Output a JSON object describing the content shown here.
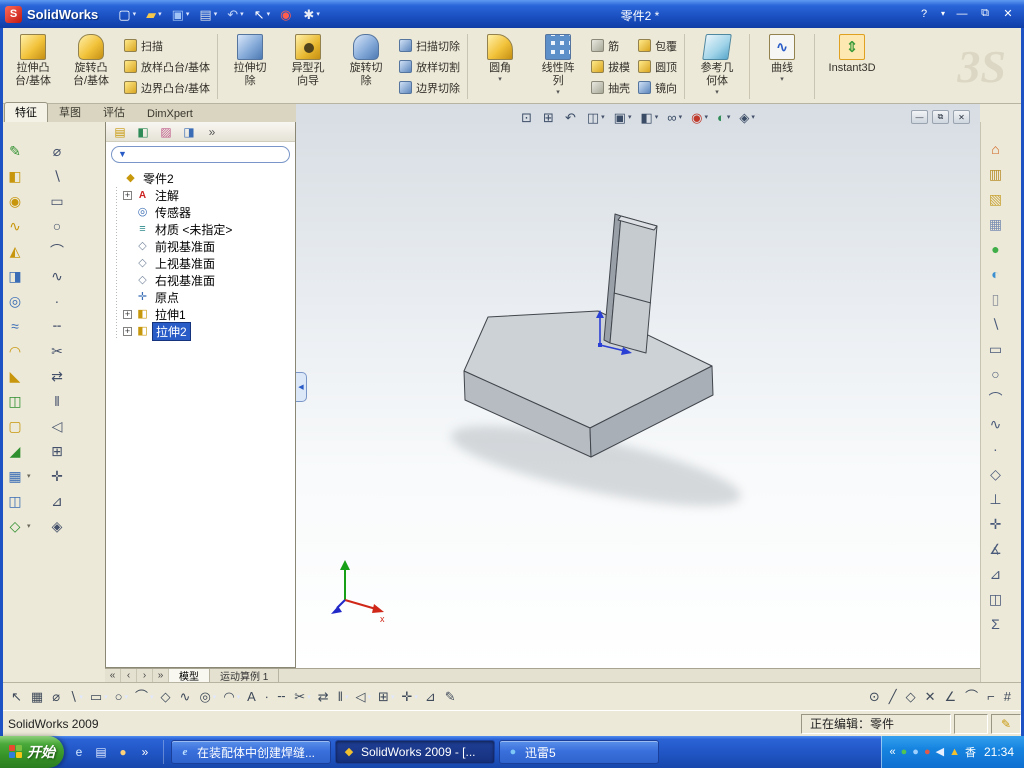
{
  "glyphs": {
    "dropdown": "▾",
    "plus": "+",
    "minimize": "—",
    "restore": "⧉",
    "close": "✕",
    "funnel": "▼",
    "collapse": "◀",
    "wave": "∿",
    "updown": "⇕"
  },
  "window": {
    "logo_badge": "S",
    "app_name": "SolidWorks",
    "title": "零件2 *",
    "help_label": "?"
  },
  "titlebar_tools": [
    {
      "name": "new-document-icon",
      "glyph": "▢",
      "color": "#ffffff",
      "arrow": true
    },
    {
      "name": "open-document-icon",
      "glyph": "▰",
      "color": "#f5c84c",
      "arrow": true
    },
    {
      "name": "save-icon",
      "glyph": "▣",
      "color": "#9fc3f5",
      "arrow": true
    },
    {
      "name": "print-icon",
      "glyph": "▤",
      "color": "#d5dce8",
      "arrow": true
    },
    {
      "name": "undo-icon",
      "glyph": "↶",
      "color": "#bcd2f7",
      "arrow": true
    },
    {
      "name": "select-icon",
      "glyph": "↖",
      "color": "#ffffff",
      "arrow": true
    },
    {
      "name": "rebuild-icon",
      "glyph": "◉",
      "color": "#ff5d4d",
      "arrow": false
    },
    {
      "name": "options-icon",
      "glyph": "✱",
      "color": "#e8edf6",
      "arrow": true
    }
  ],
  "ribbon": {
    "watermark": "3S",
    "groups": [
      {
        "name": "extruded-boss-base",
        "lines": [
          "拉伸凸",
          "台/基体"
        ]
      },
      {
        "name": "revolved-boss-base",
        "lines": [
          "旋转凸",
          "台/基体"
        ]
      },
      {
        "name": "boss-stack",
        "items": [
          {
            "name": "swept-boss",
            "label": "扫描"
          },
          {
            "name": "lofted-boss",
            "label": "放样凸台/基体"
          },
          {
            "name": "boundary-boss",
            "label": "边界凸台/基体"
          }
        ]
      },
      {
        "name": "extruded-cut",
        "lines": [
          "拉伸切",
          "除"
        ]
      },
      {
        "name": "hole-wizard",
        "lines": [
          "异型孔",
          "向导"
        ]
      },
      {
        "name": "revolved-cut",
        "lines": [
          "旋转切",
          "除"
        ]
      },
      {
        "name": "cut-stack",
        "items": [
          {
            "name": "swept-cut",
            "label": "扫描切除"
          },
          {
            "name": "lofted-cut",
            "label": "放样切割"
          },
          {
            "name": "boundary-cut",
            "label": "边界切除"
          }
        ]
      },
      {
        "name": "fillet",
        "lines": [
          "圆角"
        ],
        "arrow": true
      },
      {
        "name": "linear-pattern",
        "lines": [
          "线性阵",
          "列"
        ],
        "arrow": true
      },
      {
        "name": "rib-stack",
        "items": [
          {
            "name": "rib",
            "label": "筋"
          },
          {
            "name": "draft",
            "label": "拔模"
          },
          {
            "name": "shell",
            "label": "抽壳"
          }
        ]
      },
      {
        "name": "wrap-stack",
        "items": [
          {
            "name": "wrap",
            "label": "包覆"
          },
          {
            "name": "dome",
            "label": "圆顶"
          },
          {
            "name": "mirror",
            "label": "镜向"
          }
        ]
      },
      {
        "name": "reference-geometry",
        "lines": [
          "参考几",
          "何体"
        ],
        "arrow": true
      },
      {
        "name": "curves",
        "lines": [
          "曲线"
        ],
        "arrow": true
      },
      {
        "name": "instant3d",
        "lines": [
          "Instant3D"
        ]
      }
    ]
  },
  "tabs": [
    "特征",
    "草图",
    "评估",
    "DimXpert"
  ],
  "manager_tabs": [
    {
      "name": "featuremanager-tab-icon",
      "glyph": "▤",
      "color": "#c8980c"
    },
    {
      "name": "propertymanager-tab-icon",
      "glyph": "◧",
      "color": "#2e8b57"
    },
    {
      "name": "configurationmanager-tab-icon",
      "glyph": "▨",
      "color": "#c05a8a"
    },
    {
      "name": "dimxpertmanager-tab-icon",
      "glyph": "◨",
      "color": "#3a6db5"
    },
    {
      "name": "panel-overflow-icon",
      "glyph": "»",
      "color": "#555555"
    }
  ],
  "feature_panel": {
    "filter_placeholder": "",
    "items": [
      {
        "label": "零件2",
        "glyph": "◆"
      },
      {
        "label": "注解",
        "glyph": "A"
      },
      {
        "label": "传感器",
        "glyph": "◎"
      },
      {
        "label": "材质 <未指定>",
        "glyph": "≡"
      },
      {
        "label": "前视基准面",
        "glyph": "◇"
      },
      {
        "label": "上视基准面",
        "glyph": "◇"
      },
      {
        "label": "右视基准面",
        "glyph": "◇"
      },
      {
        "label": "原点",
        "glyph": "✛"
      },
      {
        "label": "拉伸1",
        "glyph": "◧"
      },
      {
        "label": "拉伸2",
        "glyph": "◧"
      }
    ]
  },
  "headsup_tools": [
    {
      "name": "zoom-to-fit-icon",
      "glyph": "⊡",
      "color": "#3b4c66"
    },
    {
      "name": "zoom-to-area-icon",
      "glyph": "⊞",
      "color": "#3b4c66"
    },
    {
      "name": "previous-view-icon",
      "glyph": "↶",
      "color": "#3b4c66"
    },
    {
      "name": "section-view-icon",
      "glyph": "◫",
      "color": "#3b4c66",
      "arrow": true
    },
    {
      "name": "view-orientation-icon",
      "glyph": "▣",
      "color": "#3b4c66",
      "arrow": true
    },
    {
      "name": "display-style-icon",
      "glyph": "◧",
      "color": "#3b4c66",
      "arrow": true
    },
    {
      "name": "hide-show-items-icon",
      "glyph": "∞",
      "color": "#3b4c66",
      "arrow": true
    },
    {
      "name": "edit-appearance-icon",
      "glyph": "◉",
      "color": "#c0392b",
      "arrow": true
    },
    {
      "name": "apply-scene-icon",
      "glyph": "◐",
      "color": "#2e8b57",
      "arrow": true
    },
    {
      "name": "view-settings-icon",
      "glyph": "◈",
      "color": "#3b4c66",
      "arrow": true
    }
  ],
  "left_toolbar_1": [
    {
      "name": "sketch-icon",
      "glyph": "✎",
      "color": "#2f8f2f"
    },
    {
      "name": "extruded-boss-icon",
      "glyph": "◧",
      "color": "#c8960c"
    },
    {
      "name": "revolved-boss-icon",
      "glyph": "◉",
      "color": "#c8960c"
    },
    {
      "name": "swept-boss-icon",
      "glyph": "∿",
      "color": "#c8960c"
    },
    {
      "name": "lofted-boss-icon",
      "glyph": "◭",
      "color": "#c8960c"
    },
    {
      "name": "extruded-cut-icon",
      "glyph": "◨",
      "color": "#3a6db5"
    },
    {
      "name": "revolved-cut-icon",
      "glyph": "◎",
      "color": "#3a6db5"
    },
    {
      "name": "swept-cut-icon",
      "glyph": "≈",
      "color": "#3a6db5"
    },
    {
      "name": "fillet-icon",
      "glyph": "◠",
      "color": "#c8960c"
    },
    {
      "name": "chamfer-icon",
      "glyph": "◣",
      "color": "#c8960c"
    },
    {
      "name": "rib-icon",
      "glyph": "◫",
      "color": "#2f8f2f"
    },
    {
      "name": "shell-icon",
      "glyph": "▢",
      "color": "#c8960c"
    },
    {
      "name": "draft-icon",
      "glyph": "◢",
      "color": "#2f8f2f"
    },
    {
      "name": "linear-pattern-icon",
      "glyph": "▦",
      "color": "#3a6db5",
      "arrow": true
    },
    {
      "name": "mirror-feature-icon",
      "glyph": "◫",
      "color": "#3a6db5"
    },
    {
      "name": "reference-geometry-icon",
      "glyph": "◇",
      "color": "#2f8f2f",
      "arrow": true
    }
  ],
  "left_toolbar_2": [
    {
      "name": "smart-dimension-icon",
      "glyph": "⌀",
      "color": "#44506a"
    },
    {
      "name": "line-icon",
      "glyph": "∖",
      "color": "#44506a"
    },
    {
      "name": "rectangle-icon",
      "glyph": "▭",
      "color": "#44506a"
    },
    {
      "name": "circle-icon",
      "glyph": "○",
      "color": "#44506a"
    },
    {
      "name": "arc-icon",
      "glyph": "⌒",
      "color": "#44506a"
    },
    {
      "name": "spline-icon",
      "glyph": "∿",
      "color": "#44506a"
    },
    {
      "name": "point-icon",
      "glyph": "∙",
      "color": "#44506a"
    },
    {
      "name": "centerline-icon",
      "glyph": "╌",
      "color": "#44506a"
    },
    {
      "name": "trim-icon",
      "glyph": "✂",
      "color": "#44506a"
    },
    {
      "name": "convert-entities-icon",
      "glyph": "⇄",
      "color": "#44506a"
    },
    {
      "name": "offset-entities-icon",
      "glyph": "‖",
      "color": "#44506a"
    },
    {
      "name": "mirror-entities-icon",
      "glyph": "◁",
      "color": "#44506a"
    },
    {
      "name": "sketch-pattern-icon",
      "glyph": "⊞",
      "color": "#44506a"
    },
    {
      "name": "move-entities-icon",
      "glyph": "✛",
      "color": "#44506a"
    },
    {
      "name": "display-relations-icon",
      "glyph": "⊿",
      "color": "#44506a"
    },
    {
      "name": "quick-snaps-icon",
      "glyph": "◈",
      "color": "#44506a"
    }
  ],
  "right_panel_tools": [
    {
      "name": "solidworks-resources-icon",
      "glyph": "⌂",
      "color": "#d0641e"
    },
    {
      "name": "design-library-icon",
      "glyph": "▥",
      "color": "#b8912e"
    },
    {
      "name": "file-explorer-icon",
      "glyph": "▧",
      "color": "#caa53a"
    },
    {
      "name": "view-palette-icon",
      "glyph": "▦",
      "color": "#7a8fb3"
    },
    {
      "name": "appearances-icon",
      "glyph": "●",
      "color": "#3fae49"
    },
    {
      "name": "scenes-icon",
      "glyph": "◐",
      "color": "#3a8fd0"
    },
    {
      "name": "custom-properties-icon",
      "glyph": "▯",
      "color": "#8a8f99"
    },
    {
      "name": "line-tool-icon",
      "glyph": "∖",
      "color": "#4a5a7a"
    },
    {
      "name": "rectangle-tool-icon",
      "glyph": "▭",
      "color": "#4a5a7a"
    },
    {
      "name": "circle-tool-icon",
      "glyph": "○",
      "color": "#4a5a7a"
    },
    {
      "name": "arc-tool-icon",
      "glyph": "⌒",
      "color": "#4a5a7a"
    },
    {
      "name": "spline-tool-icon",
      "glyph": "∿",
      "color": "#4a5a7a"
    },
    {
      "name": "point-tool-icon",
      "glyph": "∙",
      "color": "#4a5a7a"
    },
    {
      "name": "plane-icon",
      "glyph": "◇",
      "color": "#4a5a7a"
    },
    {
      "name": "axis-icon",
      "glyph": "⊥",
      "color": "#4a5a7a"
    },
    {
      "name": "coordinate-system-icon",
      "glyph": "✛",
      "color": "#4a5a7a"
    },
    {
      "name": "measure-icon",
      "glyph": "∡",
      "color": "#4a5a7a"
    },
    {
      "name": "mass-properties-icon",
      "glyph": "⊿",
      "color": "#4a5a7a"
    },
    {
      "name": "section-properties-icon",
      "glyph": "◫",
      "color": "#4a5a7a"
    },
    {
      "name": "equations-icon",
      "glyph": "Σ",
      "color": "#4a5a7a"
    }
  ],
  "bottom_tools_left": [
    {
      "name": "select-icon",
      "glyph": "↖",
      "color": "#3f4a5a"
    },
    {
      "name": "grid-icon",
      "glyph": "▦",
      "color": "#3f4a5a"
    },
    {
      "name": "smart-dimension-icon",
      "glyph": "⌀",
      "color": "#3f4a5a"
    },
    {
      "name": "line-icon",
      "glyph": "∖",
      "color": "#3f4a5a",
      "arrow": true
    },
    {
      "name": "rectangle-icon",
      "glyph": "▭",
      "color": "#3f4a5a",
      "arrow": true
    },
    {
      "name": "circle-icon",
      "glyph": "○",
      "color": "#3f4a5a",
      "arrow": true
    },
    {
      "name": "arc-icon",
      "glyph": "⌒",
      "color": "#3f4a5a",
      "arrow": true
    },
    {
      "name": "polygon-icon",
      "glyph": "◇",
      "color": "#3f4a5a"
    },
    {
      "name": "spline-icon",
      "glyph": "∿",
      "color": "#3f4a5a"
    },
    {
      "name": "ellipse-icon",
      "glyph": "◎",
      "color": "#3f4a5a",
      "arrow": true
    },
    {
      "name": "sketch-fillet-icon",
      "glyph": "◠",
      "color": "#3f4a5a",
      "arrow": true
    },
    {
      "name": "text-icon",
      "glyph": "A",
      "color": "#3f4a5a"
    },
    {
      "name": "point-icon",
      "glyph": "∙",
      "color": "#3f4a5a"
    },
    {
      "name": "centerline-icon",
      "glyph": "╌",
      "color": "#3f4a5a"
    },
    {
      "name": "trim-entities-icon",
      "glyph": "✂",
      "color": "#3f4a5a",
      "arrow": true
    },
    {
      "name": "convert-entities-icon",
      "glyph": "⇄",
      "color": "#3f4a5a"
    },
    {
      "name": "offset-entities-icon",
      "glyph": "‖",
      "color": "#3f4a5a",
      "arrow": true
    },
    {
      "name": "mirror-entities-icon",
      "glyph": "◁",
      "color": "#3f4a5a",
      "arrow": true
    },
    {
      "name": "linear-sketch-pattern-icon",
      "glyph": "⊞",
      "color": "#3f4a5a",
      "arrow": true
    },
    {
      "name": "move-entities-icon",
      "glyph": "✛",
      "color": "#3f4a5a",
      "arrow": true
    },
    {
      "name": "display-relations-icon",
      "glyph": "⊿",
      "color": "#3f4a5a"
    },
    {
      "name": "rapid-sketch-icon",
      "glyph": "✎",
      "color": "#3f4a5a"
    }
  ],
  "bottom_tools_right": [
    {
      "name": "circle-snap-icon",
      "glyph": "⊙",
      "color": "#3f4a5a"
    },
    {
      "name": "line-snap-icon",
      "glyph": "╱",
      "color": "#3f4a5a"
    },
    {
      "name": "diamond-snap-icon",
      "glyph": "◇",
      "color": "#3f4a5a"
    },
    {
      "name": "intersection-snap-icon",
      "glyph": "✕",
      "color": "#3f4a5a"
    },
    {
      "name": "angle-snap-icon",
      "glyph": "∠",
      "color": "#3f4a5a"
    },
    {
      "name": "arc-snap-icon",
      "glyph": "⌒",
      "color": "#3f4a5a"
    },
    {
      "name": "corner-snap-icon",
      "glyph": "⌐",
      "color": "#3f4a5a"
    },
    {
      "name": "grid-snap-icon",
      "glyph": "#",
      "color": "#3f4a5a"
    }
  ],
  "bottom_tabs": {
    "nav": [
      "«",
      "‹",
      "›",
      "»"
    ],
    "tabs": [
      {
        "label": "模型",
        "active": true
      },
      {
        "label": "运动算例 1",
        "active": false
      }
    ]
  },
  "statusbar": {
    "app": "SolidWorks 2009",
    "editing": "正在编辑：零件",
    "icon": "✎"
  },
  "taskbar": {
    "start_label": "开始",
    "quick_launch": [
      {
        "name": "quick-launch-ie-icon",
        "glyph": "e",
        "color": "#cfe6ff"
      },
      {
        "name": "quick-launch-show-desktop-icon",
        "glyph": "▤",
        "color": "#dfe8ff"
      },
      {
        "name": "quick-launch-media-icon",
        "glyph": "●",
        "color": "#ffd27a"
      },
      {
        "name": "quick-launch-expand-icon",
        "glyph": "»",
        "color": "#ffffff"
      }
    ],
    "buttons": [
      {
        "label": "在装配体中创建焊缝...",
        "glyph": "e"
      },
      {
        "label": "SolidWorks 2009 - [...",
        "glyph": "◆",
        "active": true
      },
      {
        "label": "迅雷5",
        "glyph": "●"
      }
    ],
    "tray_icons": [
      {
        "name": "hide-tray-icons-chevron",
        "glyph": "«",
        "color": "#ffffff"
      },
      {
        "name": "antivirus-tray-icon",
        "glyph": "●",
        "color": "#52c452"
      },
      {
        "name": "network-tray-icon",
        "glyph": "●",
        "color": "#9cd0ff"
      },
      {
        "name": "xunlei-tray-icon",
        "glyph": "●",
        "color": "#e05a4a"
      },
      {
        "name": "volume-tray-icon",
        "glyph": "◀",
        "color": "#e8f0ff"
      },
      {
        "name": "update-tray-icon",
        "glyph": "▲",
        "color": "#f0c030"
      }
    ],
    "ime": "香",
    "time": "21:34"
  }
}
